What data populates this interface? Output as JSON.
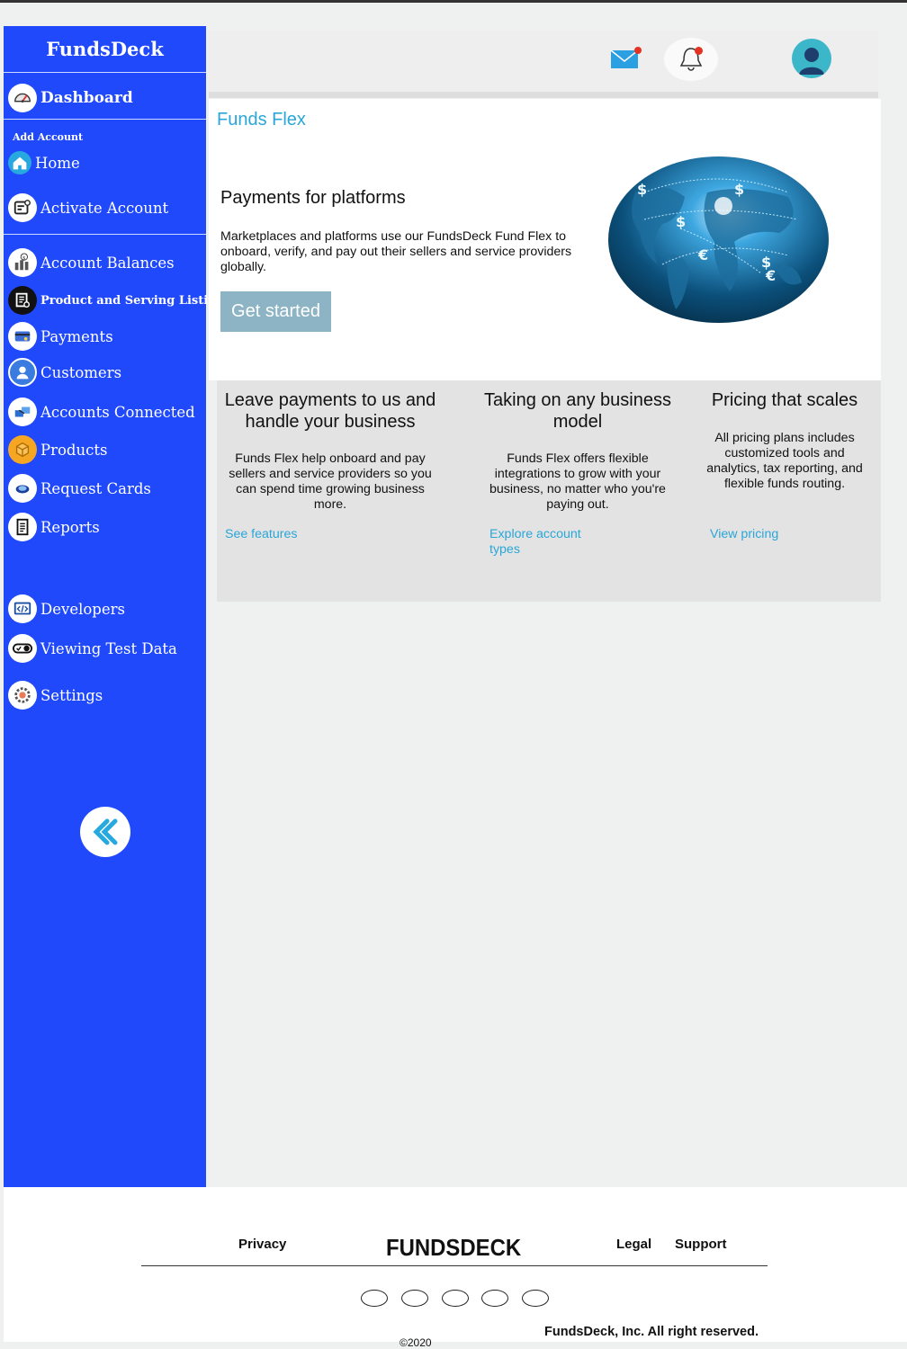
{
  "sidebar": {
    "brand": "FundsDeck",
    "dashboard": "Dashboard",
    "section_label": "Add Account",
    "items": [
      {
        "label": "Home",
        "icon": "home-icon"
      },
      {
        "label": "Activate Account",
        "icon": "activate-account-icon"
      },
      {
        "label": "Account Balances",
        "icon": "account-balances-icon"
      },
      {
        "label": "Product and Serving Listing",
        "icon": "listing-icon"
      },
      {
        "label": "Payments",
        "icon": "payments-icon"
      },
      {
        "label": "Customers",
        "icon": "customers-icon"
      },
      {
        "label": "Accounts Connected",
        "icon": "accounts-connected-icon"
      },
      {
        "label": "Products",
        "icon": "products-icon"
      },
      {
        "label": "Request Cards",
        "icon": "request-cards-icon"
      },
      {
        "label": "Reports",
        "icon": "reports-icon"
      },
      {
        "label": "Developers",
        "icon": "code-icon"
      },
      {
        "label": "Viewing Test Data",
        "icon": "toggle-icon"
      },
      {
        "label": "Settings",
        "icon": "gear-icon"
      }
    ],
    "collapse_icon": "double-chevron-left-icon",
    "color": "#2149fc"
  },
  "header": {
    "mail_icon": "mail-icon",
    "bell_icon": "bell-icon",
    "avatar_icon": "user-avatar-icon"
  },
  "hero": {
    "title": "Funds Flex",
    "heading": "Payments for platforms",
    "description": "Marketplaces and platforms use our FundsDeck Fund Flex to onboard, verify, and pay out their sellers and service providers globally.",
    "cta_label": "Get started",
    "accent": "#2aa6d8"
  },
  "features": [
    {
      "title": "Leave payments to us and handle your business",
      "body": "Funds Flex help onboard and pay sellers and service providers so you can spend time growing business more.",
      "link": "See features"
    },
    {
      "title": "Taking on any business model",
      "body": "Funds Flex offers flexible integrations to grow with your business, no matter who you're paying out.",
      "link": "Explore account types"
    },
    {
      "title": "Pricing that scales",
      "body": "All pricing plans includes customized tools and analytics, tax reporting, and flexible funds routing.",
      "link": "View pricing"
    }
  ],
  "footer": {
    "privacy": "Privacy",
    "brand": "FUNDSDECK",
    "legal": "Legal",
    "support": "Support",
    "copyright": "FundsDeck, Inc. All right reserved.",
    "year": "©2020"
  }
}
